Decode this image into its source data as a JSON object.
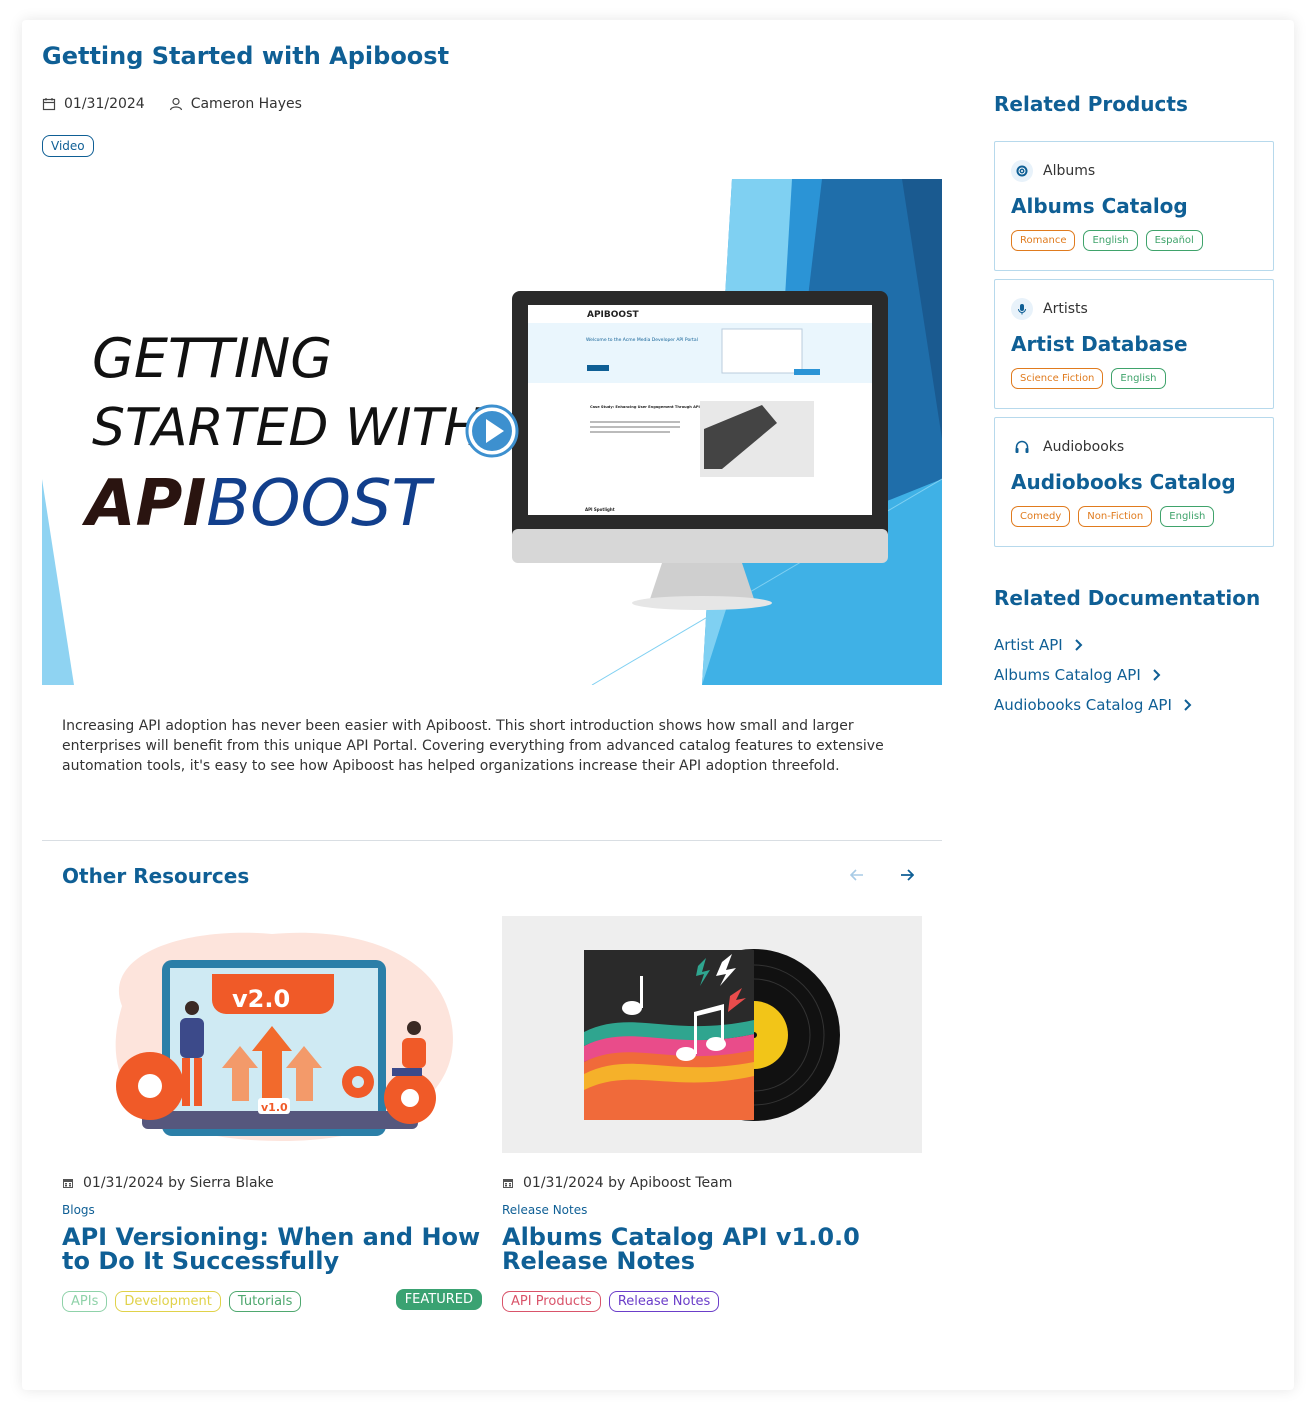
{
  "article": {
    "title": "Getting Started with Apiboost",
    "date": "01/31/2024",
    "author": "Cameron Hayes",
    "type_badge": "Video",
    "description": "Increasing API adoption has never been easier with Apiboost. This short introduction shows how small and larger enterprises will benefit from this unique API Portal. Covering everything from advanced catalog features to extensive automation tools, it's easy to see how Apiboost has helped organizations increase their API adoption threefold."
  },
  "hero": {
    "line1": "GETTING",
    "line2": "STARTED WITH",
    "brand_bold": "API",
    "brand_light": "BOOST",
    "play_icon": "play-icon",
    "screen_logo": "APIBOOST",
    "screen_welcome": "Welcome to the Acme Media Developer API Portal",
    "screen_case_study": "Case Study: Enhancing User Engagement Through API-Powered Media Streaming",
    "screen_spotlight": "API Spotlight"
  },
  "other_resources": {
    "title": "Other Resources",
    "prev_icon": "arrow-left-icon",
    "next_icon": "arrow-right-icon",
    "items": [
      {
        "meta": "01/31/2024 by Sierra Blake",
        "category": "Blogs",
        "title": "API Versioning: When and How to Do It Successfully",
        "thumb_v2": "v2.0",
        "thumb_v1": "v1.0",
        "tags": [
          {
            "label": "APIs",
            "color": "#8fd2a9"
          },
          {
            "label": "Development",
            "color": "#e0d24a"
          },
          {
            "label": "Tutorials",
            "color": "#4fa86f"
          }
        ],
        "featured": "FEATURED"
      },
      {
        "meta": "01/31/2024 by Apiboost Team",
        "category": "Release Notes",
        "title": "Albums Catalog API v1.0.0 Release Notes",
        "tags": [
          {
            "label": "API Products",
            "color": "#d9546a"
          },
          {
            "label": "Release Notes",
            "color": "#6b3ec9"
          }
        ]
      }
    ]
  },
  "sidebar": {
    "related_products_title": "Related Products",
    "products": [
      {
        "type": "Albums",
        "icon": "album-icon",
        "name": "Albums Catalog",
        "tags": [
          {
            "label": "Romance",
            "color": "#e07b1e"
          },
          {
            "label": "English",
            "color": "#3fa36b"
          },
          {
            "label": "Español",
            "color": "#3fa36b"
          }
        ]
      },
      {
        "type": "Artists",
        "icon": "microphone-icon",
        "name": "Artist Database",
        "tags": [
          {
            "label": "Science Fiction",
            "color": "#e07b1e"
          },
          {
            "label": "English",
            "color": "#3fa36b"
          }
        ]
      },
      {
        "type": "Audiobooks",
        "icon": "headphones-icon",
        "name": "Audiobooks Catalog",
        "tags": [
          {
            "label": "Comedy",
            "color": "#e07b1e"
          },
          {
            "label": "Non-Fiction",
            "color": "#e07b1e"
          },
          {
            "label": "English",
            "color": "#3fa36b"
          }
        ]
      }
    ],
    "related_docs_title": "Related Documentation",
    "docs": [
      {
        "label": "Artist API"
      },
      {
        "label": "Albums Catalog API"
      },
      {
        "label": "Audiobooks Catalog API"
      }
    ]
  },
  "colors": {
    "brand": "#0f5f95",
    "featured": "#3aa272"
  }
}
